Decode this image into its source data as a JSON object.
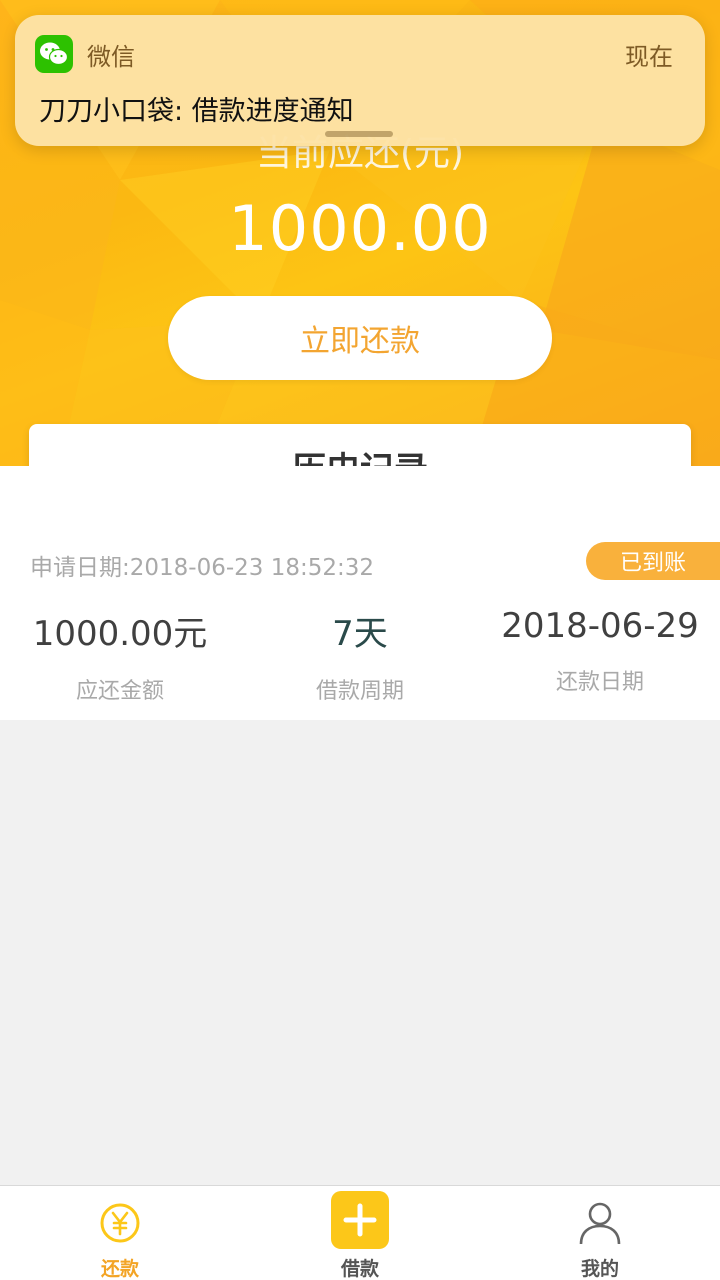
{
  "notification": {
    "app_name": "微信",
    "time": "现在",
    "message": "刀刀小口袋: 借款进度通知",
    "icon": "wechat-icon"
  },
  "hero": {
    "due_label": "当前应还(元)",
    "due_amount": "1000.00",
    "repay_button": "立即还款"
  },
  "history": {
    "title": "历史记录"
  },
  "record": {
    "apply_date": "申请日期:2018-06-23 18:52:32",
    "status": "已到账",
    "amount_value": "1000.00元",
    "amount_label": "应还金额",
    "period_value": "7天",
    "period_label": "借款周期",
    "due_date_value": "2018-06-29",
    "due_date_label": "还款日期"
  },
  "tabbar": {
    "tabs": [
      {
        "label": "还款",
        "icon": "yen-circle-icon"
      },
      {
        "label": "借款",
        "icon": "plus-icon"
      },
      {
        "label": "我的",
        "icon": "person-icon"
      }
    ]
  },
  "colors": {
    "brand_orange": "#f9b013",
    "accent_text": "#f3a531",
    "wechat_green": "#2dc100",
    "badge": "#f9b13c"
  }
}
